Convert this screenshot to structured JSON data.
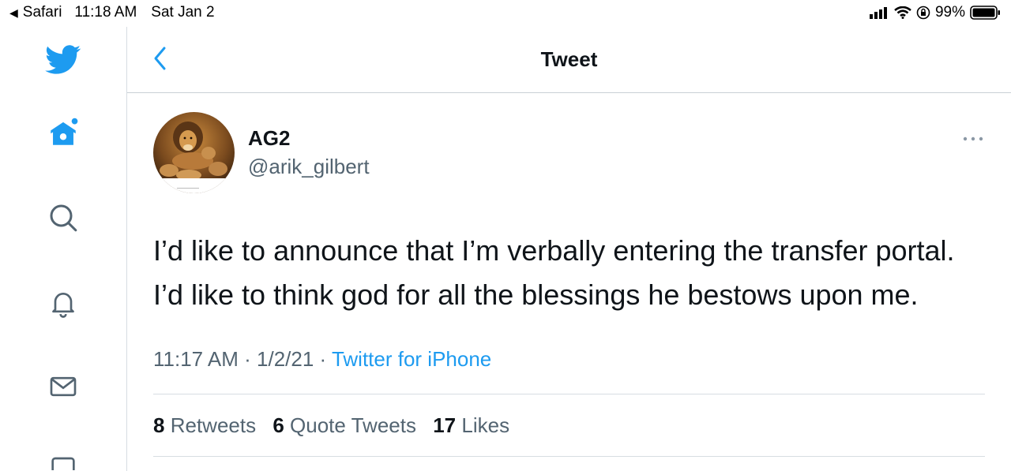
{
  "status_bar": {
    "back_app": "Safari",
    "time": "11:18 AM",
    "date": "Sat Jan 2",
    "battery": "99%"
  },
  "header": {
    "title": "Tweet"
  },
  "tweet": {
    "author_name": "AG2",
    "handle": "@arik_gilbert",
    "text_line1": "I’d like to announce that I’m verbally entering the transfer portal.",
    "text_line2": "I’d like to think god for all the blessings he bestows upon me.",
    "timestamp": "11:17 AM · 1/2/21 · ",
    "source": "Twitter for iPhone",
    "retweets_count": "8",
    "retweets_label": "Retweets",
    "quotes_count": "6",
    "quotes_label": "Quote Tweets",
    "likes_count": "17",
    "likes_label": "Likes"
  },
  "icons": {
    "rail": [
      "twitter-bird-icon",
      "home-icon",
      "search-icon",
      "bell-icon",
      "mail-icon",
      "bookmark-icon"
    ],
    "accent": "#1d9bf0"
  }
}
